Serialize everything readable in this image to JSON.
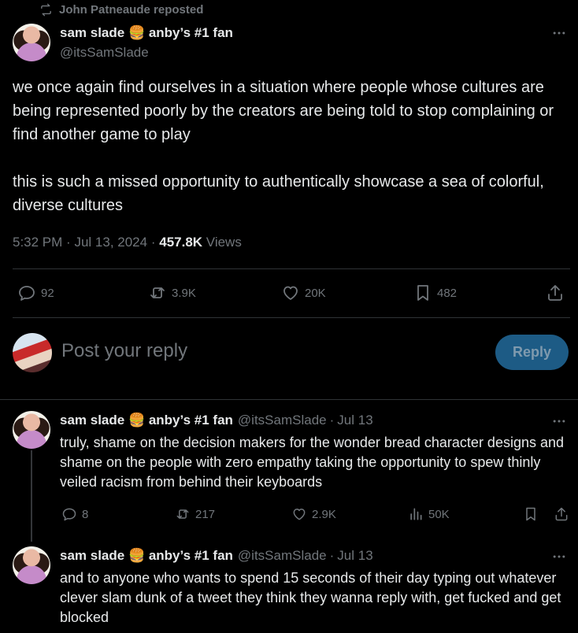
{
  "repost": {
    "label": "John Patneaude reposted"
  },
  "main_tweet": {
    "author_name": "sam slade 🍔 anby’s #1 fan",
    "handle": "@itsSamSlade",
    "paragraphs": [
      "we once again find ourselves in a situation where people whose cultures are being represented poorly by the creators are being told to stop complaining or find another game to play",
      "this is such a missed opportunity to authentically showcase a sea of colorful, diverse cultures"
    ],
    "time": "5:32 PM",
    "date": "Jul 13, 2024",
    "views_count": "457.8K",
    "views_label": "Views",
    "replies": "92",
    "reposts": "3.9K",
    "likes": "20K",
    "bookmarks": "482"
  },
  "composer": {
    "placeholder": "Post your reply",
    "button_label": "Reply"
  },
  "replies": [
    {
      "author_name": "sam slade 🍔 anby’s #1 fan",
      "handle": "@itsSamSlade",
      "date": "Jul 13",
      "text": "truly, shame on the decision makers for the wonder bread character designs and shame on the people with zero empathy taking the opportunity to spew thinly veiled racism from behind their keyboards",
      "replies": "8",
      "reposts": "217",
      "likes": "2.9K",
      "views": "50K"
    },
    {
      "author_name": "sam slade 🍔 anby’s #1 fan",
      "handle": "@itsSamSlade",
      "date": "Jul 13",
      "text": "and to anyone who wants to spend 15 seconds of their day typing out whatever clever slam dunk of a tweet they think they wanna reply with, get fucked and get blocked"
    }
  ],
  "separator": "·",
  "icons": [
    "repost-icon",
    "more-icon",
    "reply-icon",
    "like-icon",
    "bookmark-icon",
    "share-icon",
    "views-icon"
  ],
  "colors": {
    "background": "#000000",
    "text": "#e7e9ea",
    "muted": "#71767b",
    "divider": "#2f3336",
    "reply_button": "#1d5b85"
  }
}
